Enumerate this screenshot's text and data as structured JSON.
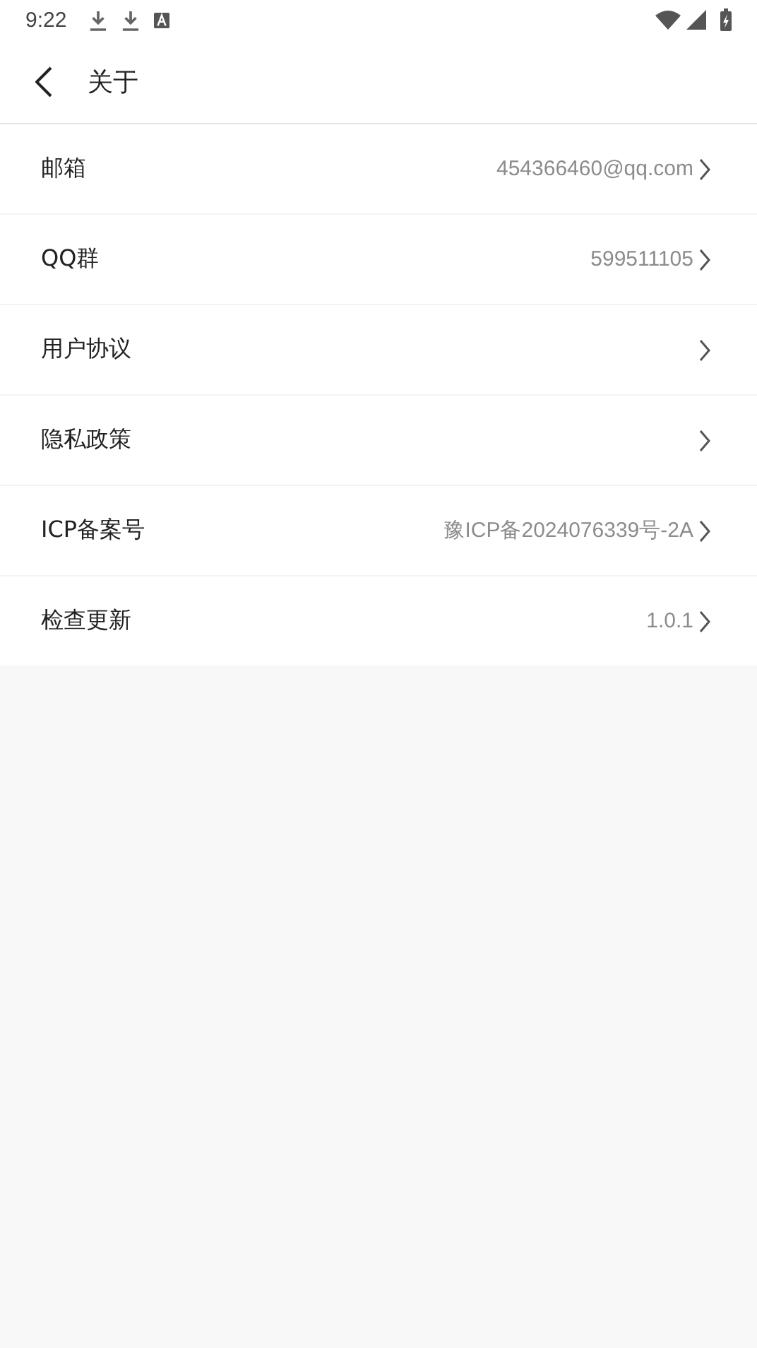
{
  "status_bar": {
    "time": "9:22"
  },
  "header": {
    "title": "关于"
  },
  "rows": [
    {
      "label": "邮箱",
      "value": "454366460@qq.com"
    },
    {
      "label": "QQ群",
      "value": "599511105"
    },
    {
      "label": "用户协议"
    },
    {
      "label": "隐私政策"
    },
    {
      "label": "ICP备案号",
      "value": "豫ICP备2024076339号-2A"
    },
    {
      "label": "检查更新",
      "value": "1.0.1"
    }
  ]
}
